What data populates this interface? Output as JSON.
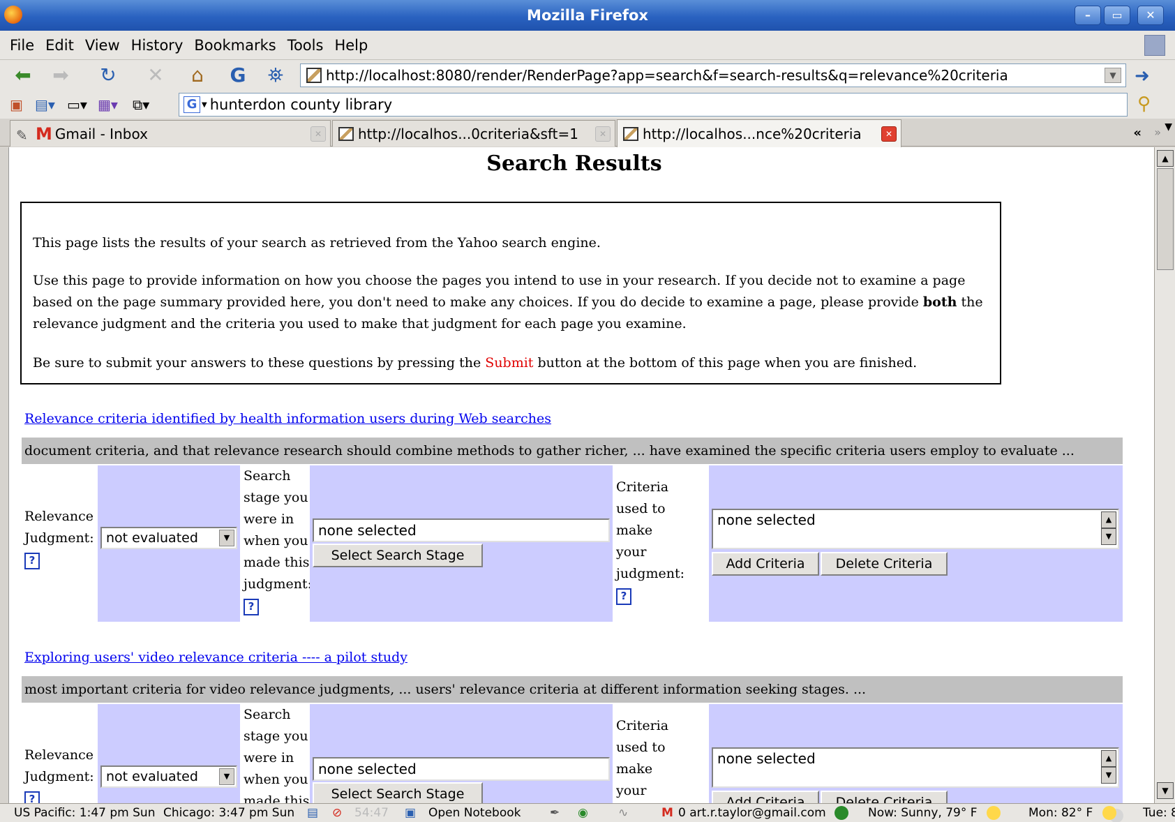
{
  "window": {
    "title": "Mozilla Firefox"
  },
  "menu": {
    "items": [
      "File",
      "Edit",
      "View",
      "History",
      "Bookmarks",
      "Tools",
      "Help"
    ]
  },
  "navigation": {
    "url": "http://localhost:8080/render/RenderPage?app=search&f=search-results&q=relevance%20criteria"
  },
  "search_bar": {
    "value": "hunterdon county library"
  },
  "tabs": [
    {
      "label": "Gmail - Inbox",
      "icon": "gmail-icon"
    },
    {
      "label": "http://localhos...0criteria&sft=1",
      "icon": "page-icon"
    },
    {
      "label": "http://localhos...nce%20criteria",
      "icon": "page-icon"
    }
  ],
  "page": {
    "title": "Search Results",
    "intro": {
      "p1": "This page lists the results of your search as retrieved from the Yahoo search engine.",
      "p2_a": "Use this page to provide information on how you choose the pages you intend to use in your research. If you decide not to examine a page based on the page summary provided here, you don't need to make any choices. If you do decide to examine a page, please provide ",
      "p2_bold": "both",
      "p2_b": " the relevance judgment and the criteria you used to make that judgment for each page you examine.",
      "p3_a": "Be sure to submit your answers to these questions by pressing the ",
      "p3_red": "Submit",
      "p3_b": " button at the bottom of this page when you are finished."
    },
    "labels": {
      "relevance_1": "Relevance",
      "relevance_2": "Judgment:",
      "stage_1": "Search",
      "stage_2": "stage you",
      "stage_3": "were in",
      "stage_4": "when you",
      "stage_5": "made this",
      "stage_6": "judgment:",
      "criteria_1": "Criteria",
      "criteria_2": "used to",
      "criteria_3": "make",
      "criteria_4": "your",
      "criteria_5": "judgment:",
      "help": "?"
    },
    "results": [
      {
        "title": "Relevance criteria identified by health information users during Web searches",
        "summary": "document criteria, and that relevance research should combine methods to gather richer, ... have examined the specific criteria users employ to evaluate ...",
        "judgment": "not evaluated",
        "stage_value": "none selected",
        "stage_button": "Select Search Stage",
        "criteria_value": "none selected",
        "add_button": "Add Criteria",
        "delete_button": "Delete Criteria"
      },
      {
        "title": "Exploring users' video relevance criteria ---- a pilot study",
        "summary": "most important criteria for video relevance judgments, ... users' relevance criteria at different information seeking stages. ...",
        "judgment": "not evaluated",
        "stage_value": "none selected",
        "stage_button": "Select Search Stage",
        "criteria_value": "none selected",
        "add_button": "Add Criteria",
        "delete_button": "Delete Criteria"
      }
    ]
  },
  "statusbar": {
    "clock_pacific": "US Pacific: 1:47 pm Sun",
    "clock_chicago": "Chicago: 3:47 pm Sun",
    "timer": "54:47",
    "notebook": "Open Notebook",
    "gmail": "0 art.r.taylor@gmail.com",
    "weather_now": "Now: Sunny, 79° F",
    "weather_mon": "Mon: 82° F",
    "weather_tue": "Tue: 8"
  },
  "colors": {
    "titlebar": "#2a62c0",
    "evaluation_cell": "#ccccff",
    "summary_band": "#c0c0c0",
    "link": "#0000ee",
    "submit_text": "#e00000"
  }
}
